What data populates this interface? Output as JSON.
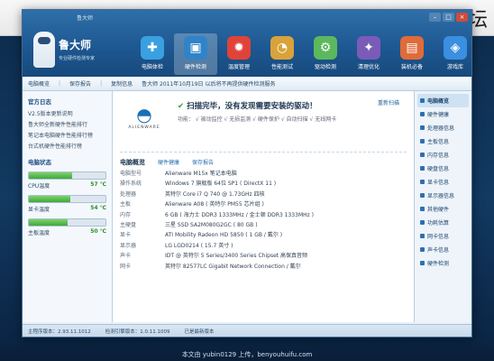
{
  "site_watermark": "电脑硬件论坛",
  "window": {
    "caption": "鲁大师",
    "controls": [
      "–",
      "□",
      "×"
    ]
  },
  "logo": {
    "name": "鲁大师",
    "tagline": "专业硬件检测专家"
  },
  "toolbar": [
    {
      "label": "电脑体检",
      "icon": "stethoscope-icon",
      "color": "#3aa0e0"
    },
    {
      "label": "硬件检测",
      "icon": "chip-icon",
      "color": "#2f84c8"
    },
    {
      "label": "温度管理",
      "icon": "thermometer-icon",
      "color": "#e0433a"
    },
    {
      "label": "性能测试",
      "icon": "gauge-icon",
      "color": "#d9a23a"
    },
    {
      "label": "驱动检测",
      "icon": "driver-icon",
      "color": "#5cb85c"
    },
    {
      "label": "清理优化",
      "icon": "broom-icon",
      "color": "#7b5bb8"
    },
    {
      "label": "装机必备",
      "icon": "box-icon",
      "color": "#e06b3a"
    },
    {
      "label": "游戏库",
      "icon": "gamepad-icon",
      "color": "#3a8fe0"
    }
  ],
  "subbar": {
    "items": [
      "电脑概览",
      "保存报告",
      "复制信息"
    ],
    "notice": "鲁大师 2011年10月19日 以后将不再提供硬件检测服务"
  },
  "left_panel": {
    "log_title": "官方日志",
    "logs": [
      "V2.5版本更新说明",
      "鲁大师全新硬件性能排行",
      "笔记本电脑硬件性能排行榜",
      "台式机硬件性能排行榜"
    ],
    "status_title": "电脑状态",
    "meters": [
      {
        "label": "CPU温度",
        "value": "57 ℃",
        "level": 0.57
      },
      {
        "label": "显卡温度",
        "value": "54 ℃",
        "level": 0.54
      },
      {
        "label": "主板温度",
        "value": "50 ℃",
        "level": 0.5
      }
    ]
  },
  "scan": {
    "brand": "ALIENWARE",
    "title_prefix": "扫描完毕，",
    "title_main": "没有发现需要安装的驱动！",
    "action": "重新扫描",
    "subline": "功能：  √ 被动监控   √ 无损监测   √ 硬件保护   √ 自动扫描   √ 无线网卡"
  },
  "overview": {
    "title": "电脑概览",
    "links": [
      "硬件健康",
      "保存报告"
    ],
    "specs": [
      {
        "label": "电脑型号",
        "value": "Alienware M15x 笔记本电脑"
      },
      {
        "label": "操作系统",
        "value": "Windows 7 旗舰版 64位 SP1 ( DirectX 11 )"
      },
      {
        "label": "处理器",
        "value": "英特尔 Core i7 Q 740 @ 1.73GHz 四核"
      },
      {
        "label": "主板",
        "value": "Alienware A08 ( 英特尔 PM55 芯片组 )"
      },
      {
        "label": "内存",
        "value": "6 GB ( 海力士 DDR3 1333MHz / 金士顿 DDR3 1333MHz )"
      },
      {
        "label": "主硬盘",
        "value": "三星 SSD SA2M080G2GC ( 80 GB )"
      },
      {
        "label": "显卡",
        "value": "ATI Mobility Radeon HD 5850 ( 1 GB / 戴尔 )"
      },
      {
        "label": "显示器",
        "value": "LG LGD0214 ( 15.7 英寸 )"
      },
      {
        "label": "声卡",
        "value": "IDT @ 英特尔 5 Series/3400 Series Chipset 高保真音频"
      },
      {
        "label": "网卡",
        "value": "英特尔 82577LC Gigabit Network Connection / 戴尔"
      }
    ]
  },
  "right_nav": [
    "电脑概览",
    "硬件健康",
    "处理器信息",
    "主板信息",
    "内存信息",
    "硬盘信息",
    "显卡信息",
    "显示器信息",
    "其他硬件",
    "功耗估算",
    "网卡信息",
    "声卡信息",
    "硬件检测"
  ],
  "statusbar": {
    "version": "主程序版本：2.93.11.1012",
    "engine": "检测引擎版本：1.0.11.1009",
    "state": "已是最新版本"
  },
  "credit": "本文由 yubin0129 上传，benyouhuifu.com"
}
